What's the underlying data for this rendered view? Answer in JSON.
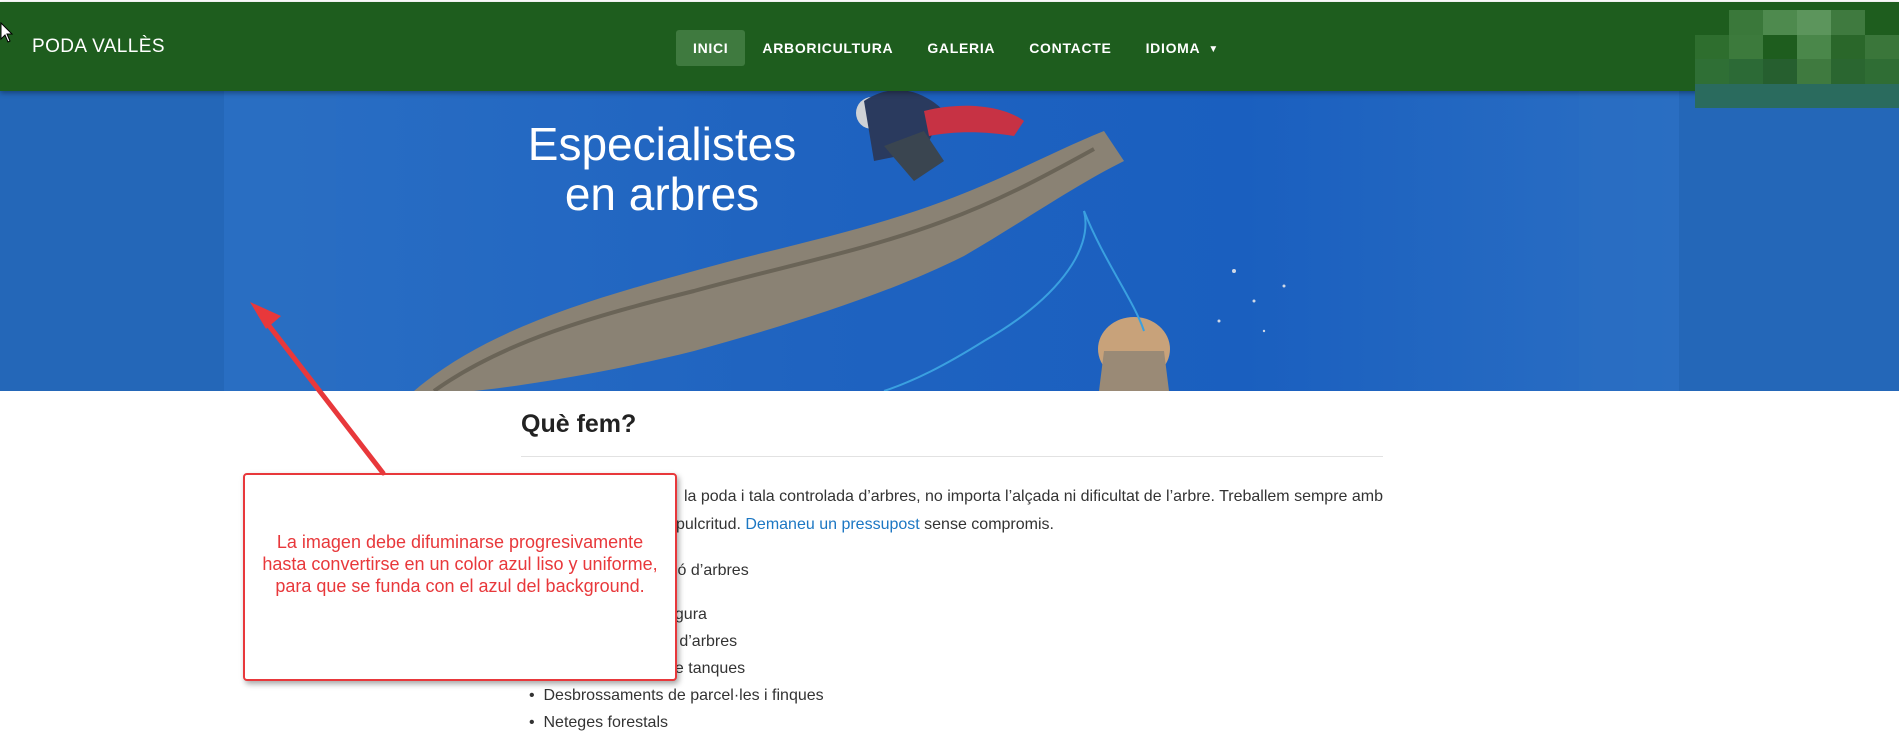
{
  "navbar": {
    "brand": "PODA VALLÈS",
    "items": [
      {
        "label": "INICI",
        "active": true
      },
      {
        "label": "ARBORICULTURA",
        "active": false
      },
      {
        "label": "GALERIA",
        "active": false
      },
      {
        "label": "CONTACTE",
        "active": false
      },
      {
        "label": "IDIOMA",
        "active": false,
        "has_dropdown": true
      }
    ],
    "background_color": "#1e5d1e",
    "active_color": "#3f7a3f"
  },
  "hero": {
    "title_line1": "Especialistes",
    "title_line2": "en arbres",
    "background_color": "#2467b8"
  },
  "main": {
    "section_title": "Què fem?",
    "paragraph_line1": "la poda i tala controlada d’arbres, no importa l’alçada ni dificultat de l’arbre. Treballem sempre amb",
    "paragraph_line2_prefix": "pulcritud.",
    "paragraph_link": "Demaneu un pressupost",
    "paragraph_line2_suffix": "sense compromis.",
    "list_items": [
      "ció d’arbres",
      "",
      "egura",
      "ó d’arbres",
      "de tanques",
      "Desbrossaments de parcel·les i finques",
      "Neteges forestals"
    ],
    "link_color": "#1c77c3"
  },
  "annotation": {
    "text": "La imagen debe difuminarse progresivamente hasta convertirse en un color azul liso y uniforme, para que se funda con el azul del background.",
    "color": "#e8383b"
  }
}
